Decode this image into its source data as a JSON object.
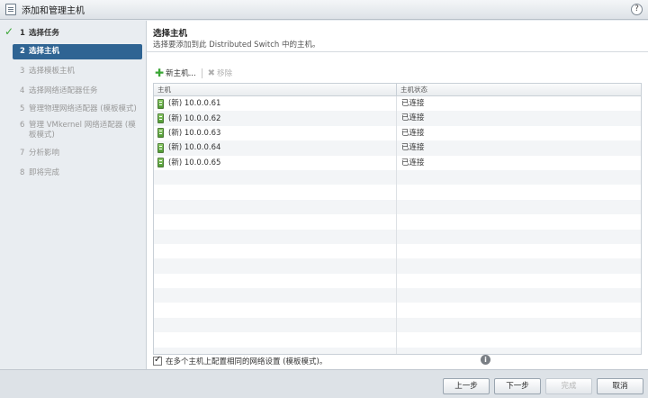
{
  "window": {
    "title": "添加和管理主机",
    "help": "?"
  },
  "steps": [
    {
      "num": "1",
      "label": "选择任务"
    },
    {
      "num": "2",
      "label": "选择主机"
    },
    {
      "num": "3",
      "label": "选择模板主机"
    },
    {
      "num": "4",
      "label": "选择网络适配器任务"
    },
    {
      "num": "5",
      "label": "管理物理网络适配器 (模板模式)"
    },
    {
      "num": "6",
      "label": "管理 VMkernel 网络适配器 (模板模式)"
    },
    {
      "num": "7",
      "label": "分析影响"
    },
    {
      "num": "8",
      "label": "即将完成"
    }
  ],
  "content": {
    "heading": "选择主机",
    "description": "选择要添加到此 Distributed Switch 中的主机。"
  },
  "toolbar": {
    "new_host": "新主机...",
    "remove": "移除"
  },
  "table": {
    "columns": [
      "主机",
      "主机状态"
    ],
    "rows": [
      {
        "host": "(新) 10.0.0.61",
        "status": "已连接"
      },
      {
        "host": "(新) 10.0.0.62",
        "status": "已连接"
      },
      {
        "host": "(新) 10.0.0.63",
        "status": "已连接"
      },
      {
        "host": "(新) 10.0.0.64",
        "status": "已连接"
      },
      {
        "host": "(新) 10.0.0.65",
        "status": "已连接"
      }
    ]
  },
  "checkbox": {
    "label": "在多个主机上配置相同的网络设置 (模板模式)。",
    "checked": true
  },
  "buttons": {
    "back": "上一步",
    "next": "下一步",
    "finish": "完成",
    "cancel": "取消"
  }
}
